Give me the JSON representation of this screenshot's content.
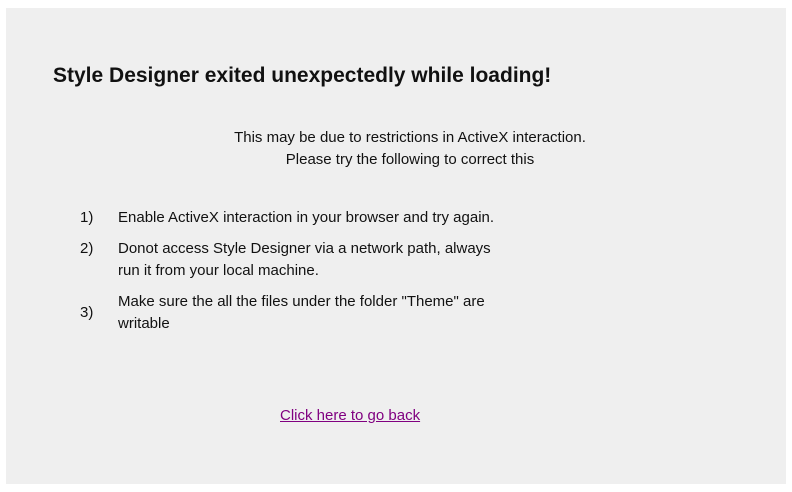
{
  "error": {
    "title": "Style Designer exited unexpectedly while loading!",
    "intro_line1": "This may be due to restrictions in ActiveX interaction.",
    "intro_line2": "Please try the following to correct this"
  },
  "steps": [
    {
      "number": "1)",
      "lines": [
        "Enable ActiveX interaction in your browser and try again."
      ]
    },
    {
      "number": "2)",
      "lines": [
        "Donot access Style Designer via a network path, always",
        "run it from your local machine."
      ]
    },
    {
      "number": "3)",
      "lines": [
        "Make sure the all the files under the folder \"Theme\" are",
        "writable"
      ]
    }
  ],
  "back_link": {
    "label": "Click here to go back",
    "color": "#800080"
  },
  "colors": {
    "background": "#efefef",
    "text": "#111111"
  }
}
